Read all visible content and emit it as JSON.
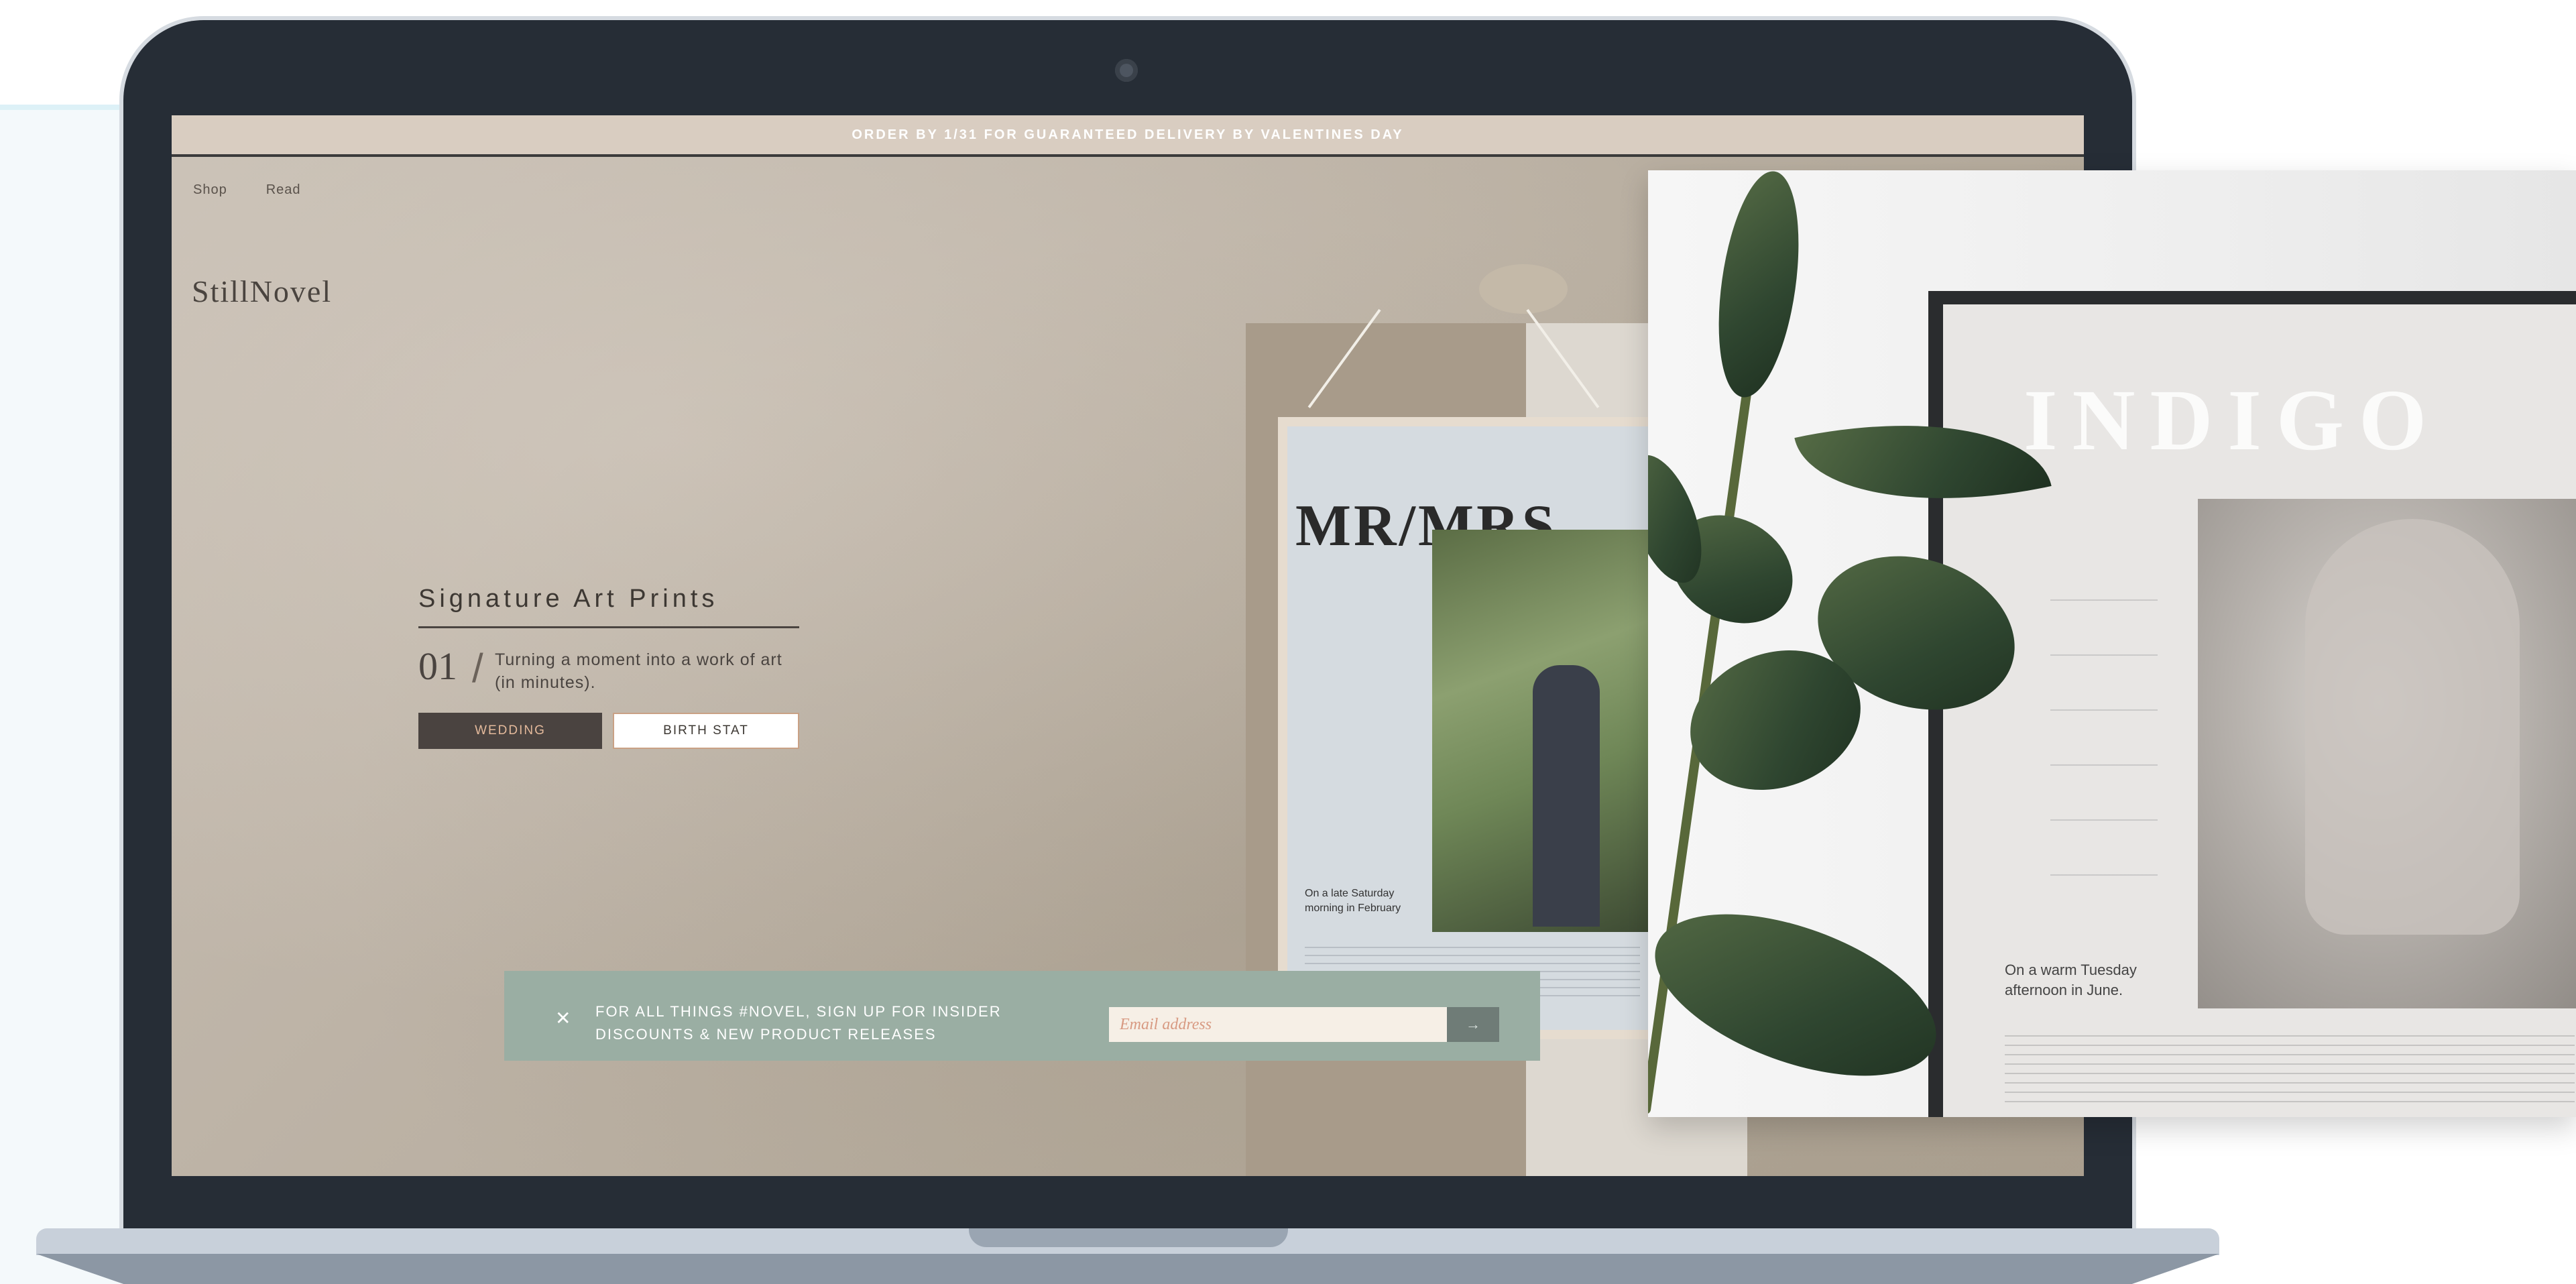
{
  "announcement": "ORDER BY 1/31 FOR GUARANTEED DELIVERY BY VALENTINES DAY",
  "nav": {
    "shop": "Shop",
    "read": "Read"
  },
  "brand": "StillNovel",
  "hero": {
    "title": "Signature Art Prints",
    "number": "01",
    "slash": "/",
    "description": "Turning a moment into a work of art (in minutes).",
    "buttons": {
      "wedding": "WEDDING",
      "birth_stat": "BIRTH STAT"
    }
  },
  "poster": {
    "title": "MR/MRS",
    "caption": "On a late Saturday morning in February"
  },
  "overlay_poster": {
    "title": "INDIGO",
    "caption": "On a warm Tuesday afternoon in June."
  },
  "newsletter": {
    "close_icon": "✕",
    "text": "FOR ALL THINGS #NOVEL, SIGN UP FOR INSIDER\nDISCOUNTS & NEW PRODUCT RELEASES",
    "email_placeholder": "Email address",
    "submit_icon": "→"
  },
  "colors": {
    "screen_bg": "#bcb2a5",
    "bezel": "#262d36",
    "announcement_bg": "#d9cdc1",
    "wedding_button": "#4a4340",
    "wedding_text": "#e3b99b",
    "newsletter_bg": "#9aaea3",
    "email_text": "#d89a82"
  }
}
